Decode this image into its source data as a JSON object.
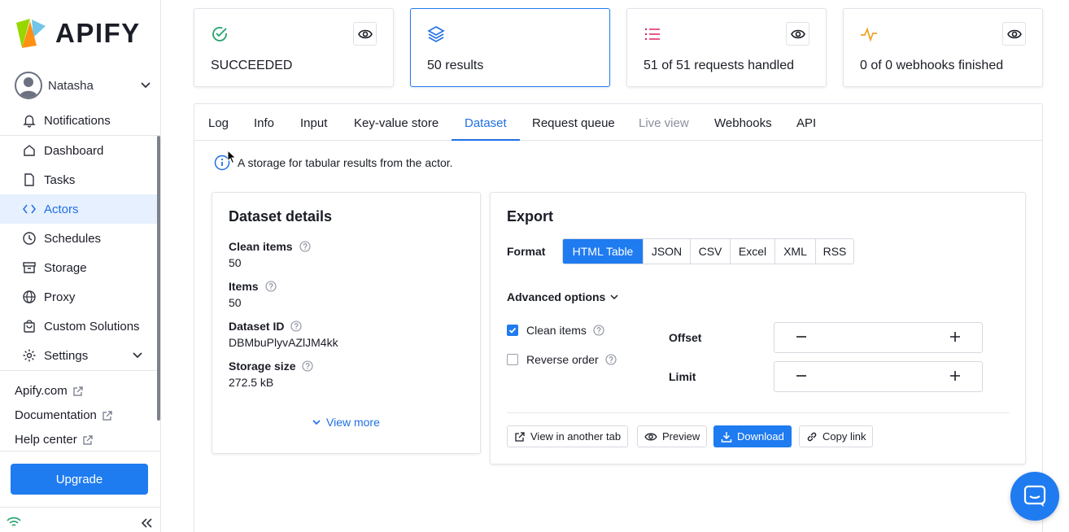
{
  "brand": {
    "name": "APIFY"
  },
  "user": {
    "name": "Natasha"
  },
  "sidebar": {
    "top_item": "Notifications",
    "items": [
      {
        "label": "Dashboard",
        "icon": "home-icon"
      },
      {
        "label": "Tasks",
        "icon": "file-icon"
      },
      {
        "label": "Actors",
        "icon": "code-icon",
        "active": true
      },
      {
        "label": "Schedules",
        "icon": "clock-icon"
      },
      {
        "label": "Storage",
        "icon": "archive-icon"
      },
      {
        "label": "Proxy",
        "icon": "globe-icon"
      },
      {
        "label": "Custom Solutions",
        "icon": "bag-icon"
      },
      {
        "label": "Settings",
        "icon": "gear-icon"
      }
    ],
    "links": [
      "Apify.com",
      "Documentation",
      "Help center"
    ],
    "upgrade_label": "Upgrade"
  },
  "stats": [
    {
      "text": "SUCCEEDED",
      "icon": "check-circle-icon"
    },
    {
      "text": "50 results",
      "icon": "layers-icon",
      "selected": true
    },
    {
      "text": "51 of 51 requests handled",
      "icon": "list-icon"
    },
    {
      "text": "0 of 0 webhooks finished",
      "icon": "activity-icon"
    }
  ],
  "tabs": [
    "Log",
    "Info",
    "Input",
    "Key-value store",
    "Dataset",
    "Request queue",
    "Live view",
    "Webhooks",
    "API"
  ],
  "active_tab": "Dataset",
  "info_text": "A storage for tabular results from the actor.",
  "dataset_details": {
    "title": "Dataset details",
    "fields": [
      {
        "label": "Clean items",
        "value": "50"
      },
      {
        "label": "Items",
        "value": "50"
      },
      {
        "label": "Dataset ID",
        "value": "DBMbuPlyvAZlJM4kk"
      },
      {
        "label": "Storage size",
        "value": "272.5 kB"
      }
    ],
    "view_more": "View more"
  },
  "export": {
    "title": "Export",
    "format_label": "Format",
    "formats": [
      "HTML Table",
      "JSON",
      "CSV",
      "Excel",
      "XML",
      "RSS"
    ],
    "selected_format": "HTML Table",
    "advanced_label": "Advanced options",
    "clean_items_label": "Clean items",
    "clean_items_checked": true,
    "reverse_order_label": "Reverse order",
    "reverse_order_checked": false,
    "offset_label": "Offset",
    "limit_label": "Limit",
    "buttons": {
      "view_tab": "View in another tab",
      "preview": "Preview",
      "download": "Download",
      "copy_link": "Copy link"
    }
  },
  "colors": {
    "accent": "#1f7bf0",
    "active_bg": "#e7f0ff",
    "success": "#22a36b"
  }
}
